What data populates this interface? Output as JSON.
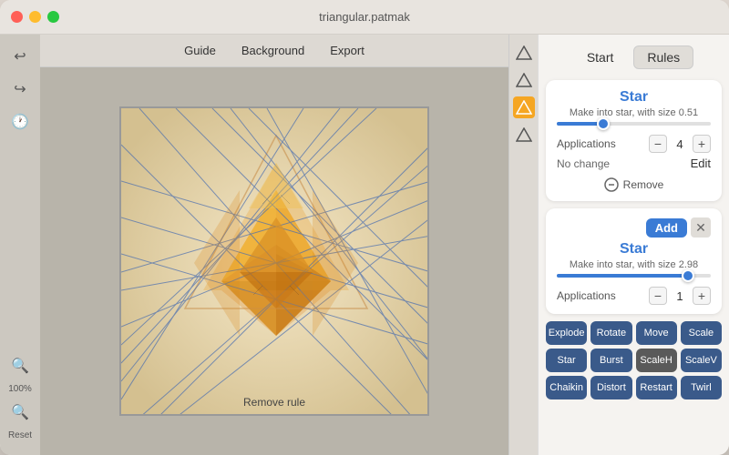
{
  "window": {
    "title": "triangular.patmak"
  },
  "toolbar": {
    "items": [
      "Guide",
      "Background",
      "Export"
    ]
  },
  "sidebar": {
    "icons": [
      "undo",
      "redo",
      "history"
    ],
    "zoom": "100%",
    "reset": "Reset"
  },
  "shapes": {
    "items": [
      "triangle1",
      "triangle2",
      "triangle3",
      "triangle4"
    ]
  },
  "right_panel": {
    "tabs": [
      "Start",
      "Rules"
    ],
    "active_tab": "Rules",
    "rules": [
      {
        "id": "rule1",
        "title": "Star",
        "subtitle": "Make into star, with size 0.51",
        "slider_pct": 30,
        "applications_label": "Applications",
        "applications_value": "4",
        "no_change_label": "No change",
        "edit_label": "Edit",
        "remove_label": "Remove"
      },
      {
        "id": "rule2",
        "title": "Star",
        "subtitle": "Make into star, with size 2.98",
        "slider_pct": 85,
        "applications_label": "Applications",
        "applications_value": "1",
        "add_label": "Add"
      }
    ],
    "transforms": [
      [
        "Explode",
        "Rotate",
        "Move",
        "Scale"
      ],
      [
        "Star",
        "Burst",
        "ScaleH",
        "ScaleV"
      ],
      [
        "Chaikin",
        "Distort",
        "Restart",
        "Twirl"
      ]
    ],
    "selected_transform": "ScaleH"
  },
  "canvas": {
    "remove_rule_label": "Remove rule"
  }
}
